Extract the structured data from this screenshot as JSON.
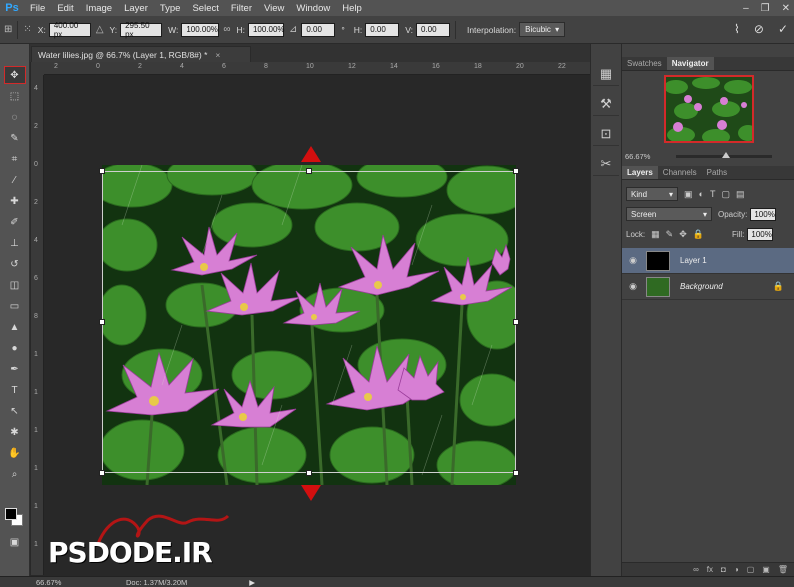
{
  "app": {
    "logo": "Ps"
  },
  "menu": [
    "File",
    "Edit",
    "Image",
    "Layer",
    "Type",
    "Select",
    "Filter",
    "View",
    "Window",
    "Help"
  ],
  "options": {
    "x_label": "X:",
    "x_value": "400.00 px",
    "y_label": "Y:",
    "y_value": "295.50 px",
    "w_label": "W:",
    "w_value": "100.00%",
    "h_label": "H:",
    "h_value": "100.00%",
    "angle_value": "0.00",
    "deg_unit": "°",
    "hskew_label": "H:",
    "hskew_value": "0.00",
    "vskew_label": "V:",
    "vskew_value": "0.00",
    "interp_label": "Interpolation:",
    "interp_value": "Bicubic"
  },
  "document": {
    "tab_title": "Water lilies.jpg @ 66.7% (Layer 1, RGB/8#) *",
    "close": "×"
  },
  "ruler_h": [
    "2",
    "0",
    "2",
    "4",
    "6",
    "8",
    "10",
    "12",
    "14",
    "16",
    "18",
    "20",
    "22"
  ],
  "ruler_v": [
    "4",
    "2",
    "0",
    "2",
    "4",
    "6",
    "8",
    "1",
    "1",
    "1",
    "1",
    "1",
    "1"
  ],
  "watermark": {
    "text": "PSDODE.IR"
  },
  "status": {
    "zoom": "66.67%",
    "doc": "Doc: 1.37M/3.20M"
  },
  "navigator": {
    "tabs": [
      "Swatches",
      "Navigator"
    ],
    "zoom": "66.67%"
  },
  "layers": {
    "tabs": [
      "Layers",
      "Channels",
      "Paths"
    ],
    "kind": "Kind",
    "blend_mode": "Screen",
    "opacity_label": "Opacity:",
    "opacity_value": "100%",
    "lock_label": "Lock:",
    "fill_label": "Fill:",
    "fill_value": "100%",
    "items": [
      {
        "name": "Layer 1",
        "selected": true
      },
      {
        "name": "Background",
        "selected": false
      }
    ],
    "footer_icons": [
      "∞",
      "fx",
      "◘",
      "◑",
      "▢",
      "▣",
      "🗑"
    ]
  }
}
